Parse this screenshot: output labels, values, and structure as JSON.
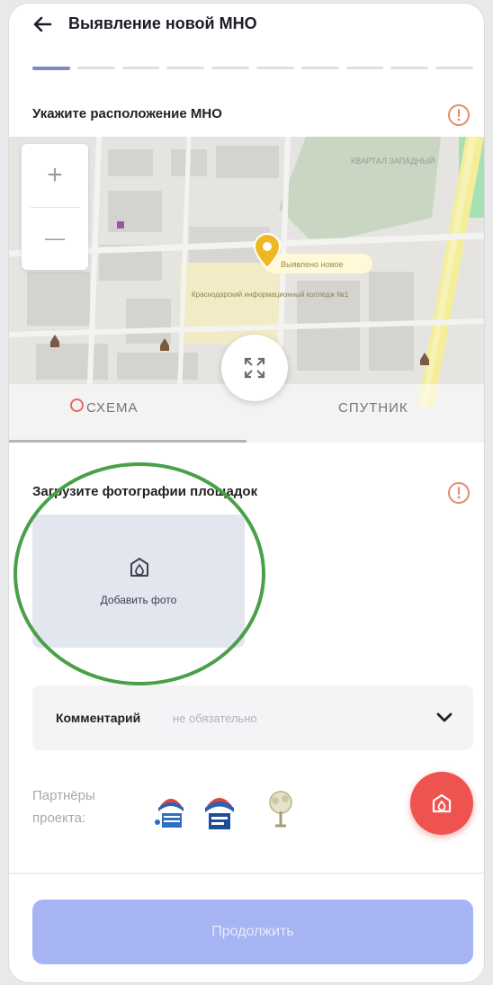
{
  "header": {
    "title": "Выявление новой МНО"
  },
  "location_section": {
    "title": "Укажите расположение МНО"
  },
  "map": {
    "zoom_in": "+",
    "zoom_out": "—",
    "marker_label": "Выявлено новое",
    "building_label": "Краснодарский информационный колледж №1",
    "area_label": "КВАРТАЛ ЗАПАДНЫЙ",
    "tabs": [
      "СХЕМА",
      "СПУТНИК"
    ]
  },
  "photo_section": {
    "title": "Загрузите фотографии площадок",
    "add_photo": "Добавить фото"
  },
  "comment": {
    "label": "Комментарий",
    "hint": "не обязательно"
  },
  "partners": {
    "label_line1": "Партнёры",
    "label_line2": "проекта:"
  },
  "footer": {
    "continue": "Продолжить"
  },
  "colors": {
    "accent": "#8289c2",
    "highlight": "#4aa049",
    "fab": "#ee5350",
    "button_disabled": "#a6b4f3",
    "info": "#e38c6a"
  },
  "icons": [
    "back-arrow-icon",
    "info-icon",
    "expand-icon",
    "add-photo-icon",
    "chevron-down-icon",
    "camera-icon"
  ]
}
